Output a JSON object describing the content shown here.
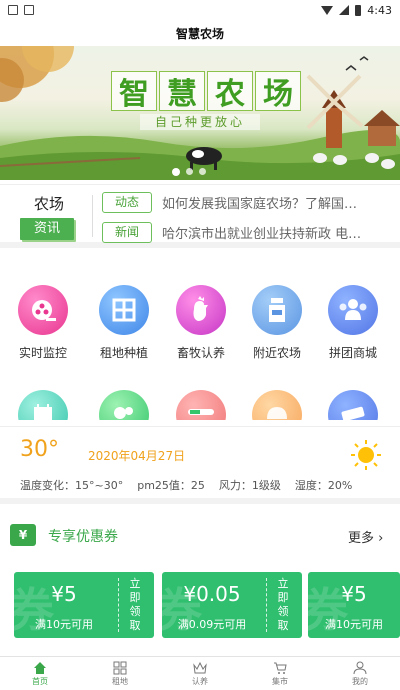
{
  "status_bar": {
    "time": "4:43"
  },
  "header": {
    "title": "智慧农场"
  },
  "banner": {
    "title_chars": [
      "智",
      "慧",
      "农",
      "场"
    ],
    "subtitle": "自己种更放心"
  },
  "news": {
    "brand_line1": "农场",
    "brand_line2": "资讯",
    "items": [
      {
        "tag": "动态",
        "text": "如何发展我国家庭农场？了解国…"
      },
      {
        "tag": "新闻",
        "text": "哈尔滨市出就业创业扶持新政 电…"
      }
    ]
  },
  "grid": {
    "items": [
      {
        "label": "实时监控",
        "icon": "camera-reel-icon",
        "color": "#e9368f"
      },
      {
        "label": "租地种植",
        "icon": "field-grid-icon",
        "color": "#3f86e8"
      },
      {
        "label": "畜牧认养",
        "icon": "rooster-icon",
        "color": "#c636c6"
      },
      {
        "label": "附近农场",
        "icon": "milk-jar-icon",
        "color": "#5b95e2"
      },
      {
        "label": "拼团商城",
        "icon": "group-people-icon",
        "color": "#5275e6"
      },
      {
        "label": "",
        "icon": "calendar-icon",
        "color": "#37c6ab"
      },
      {
        "label": "",
        "icon": "sprout-icon",
        "color": "#35c66b"
      },
      {
        "label": "",
        "icon": "fruit-basket-icon",
        "color": "#f07575"
      },
      {
        "label": "",
        "icon": "bread-icon",
        "color": "#f7a55a"
      },
      {
        "label": "",
        "icon": "tag-label-icon",
        "color": "#5275e6"
      }
    ]
  },
  "weather": {
    "temperature": "30°",
    "date": "2020年04月27日",
    "details": [
      "温度变化：15°~30°",
      "pm25值：25",
      "风力：1级级",
      "湿度：20%"
    ]
  },
  "coupons": {
    "header_icon_text": "¥",
    "title": "专享优惠券",
    "more": "更多",
    "watermark": "券",
    "items": [
      {
        "amount": "¥5",
        "condition": "满10元可用",
        "claim": [
          "立",
          "即",
          "领",
          "取"
        ]
      },
      {
        "amount": "¥0.05",
        "condition": "满0.09元可用",
        "claim": [
          "立",
          "即",
          "领",
          "取"
        ]
      },
      {
        "amount": "¥5",
        "condition": "满10元可用",
        "claim": [
          "立",
          "即",
          "领",
          "取"
        ]
      }
    ]
  },
  "tabbar": {
    "items": [
      {
        "label": "首页",
        "icon": "home-icon",
        "active": true
      },
      {
        "label": "租地",
        "icon": "grid-icon",
        "active": false
      },
      {
        "label": "认养",
        "icon": "crown-icon",
        "active": false
      },
      {
        "label": "集市",
        "icon": "cart-icon",
        "active": false
      },
      {
        "label": "我的",
        "icon": "person-icon",
        "active": false
      }
    ]
  },
  "colors": {
    "accent": "#3aa84a",
    "coupon": "#2fbf6f",
    "weather": "#f0a21c"
  }
}
